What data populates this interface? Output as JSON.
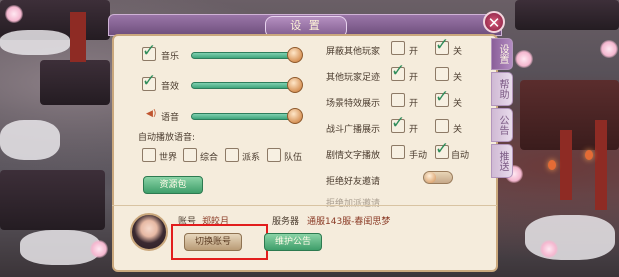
{
  "dialog": {
    "title": "设 置",
    "close_glyph": "✕"
  },
  "side_tabs": [
    {
      "label": "设置",
      "active": true
    },
    {
      "label": "帮助",
      "active": false
    },
    {
      "label": "公告",
      "active": false
    },
    {
      "label": "推送",
      "active": false
    }
  ],
  "audio": {
    "music_label": "音乐",
    "music_checked": true,
    "music_level": 1.0,
    "sfx_label": "音效",
    "sfx_checked": true,
    "sfx_level": 1.0,
    "voice_label": "语音",
    "voice_level": 1.0,
    "voice_icon": "speaker-icon"
  },
  "autoplay": {
    "label": "自动播放语音:",
    "options": [
      {
        "label": "世界",
        "checked": false
      },
      {
        "label": "综合",
        "checked": false
      },
      {
        "label": "派系",
        "checked": false
      },
      {
        "label": "队伍",
        "checked": false
      }
    ]
  },
  "resource_button": "资源包",
  "right_settings": [
    {
      "label": "屏蔽其他玩家",
      "opt1": "开",
      "opt2": "关",
      "opt1_checked": false,
      "opt2_checked": true
    },
    {
      "label": "其他玩家足迹",
      "opt1": "开",
      "opt2": "关",
      "opt1_checked": true,
      "opt2_checked": false
    },
    {
      "label": "场景特效展示",
      "opt1": "开",
      "opt2": "关",
      "opt1_checked": false,
      "opt2_checked": true
    },
    {
      "label": "战斗广播展示",
      "opt1": "开",
      "opt2": "关",
      "opt1_checked": true,
      "opt2_checked": false
    },
    {
      "label": "剧情文字播放",
      "opt1": "手动",
      "opt2": "自动",
      "opt1_checked": false,
      "opt2_checked": true
    }
  ],
  "friend_invite": {
    "label": "拒绝好友邀请",
    "on": false
  },
  "cutoff_row_label": "拒绝加派邀请",
  "account": {
    "account_label": "账号",
    "account_name": "郑皎月",
    "server_label": "服务器",
    "server_name": "通服143服-春闺思梦",
    "switch_button": "切换账号",
    "notice_button": "维护公告"
  },
  "colors": {
    "accent_green": "#3fa57c",
    "highlight_red": "#e21d1d",
    "frame_purple": "#6f4f7d"
  }
}
